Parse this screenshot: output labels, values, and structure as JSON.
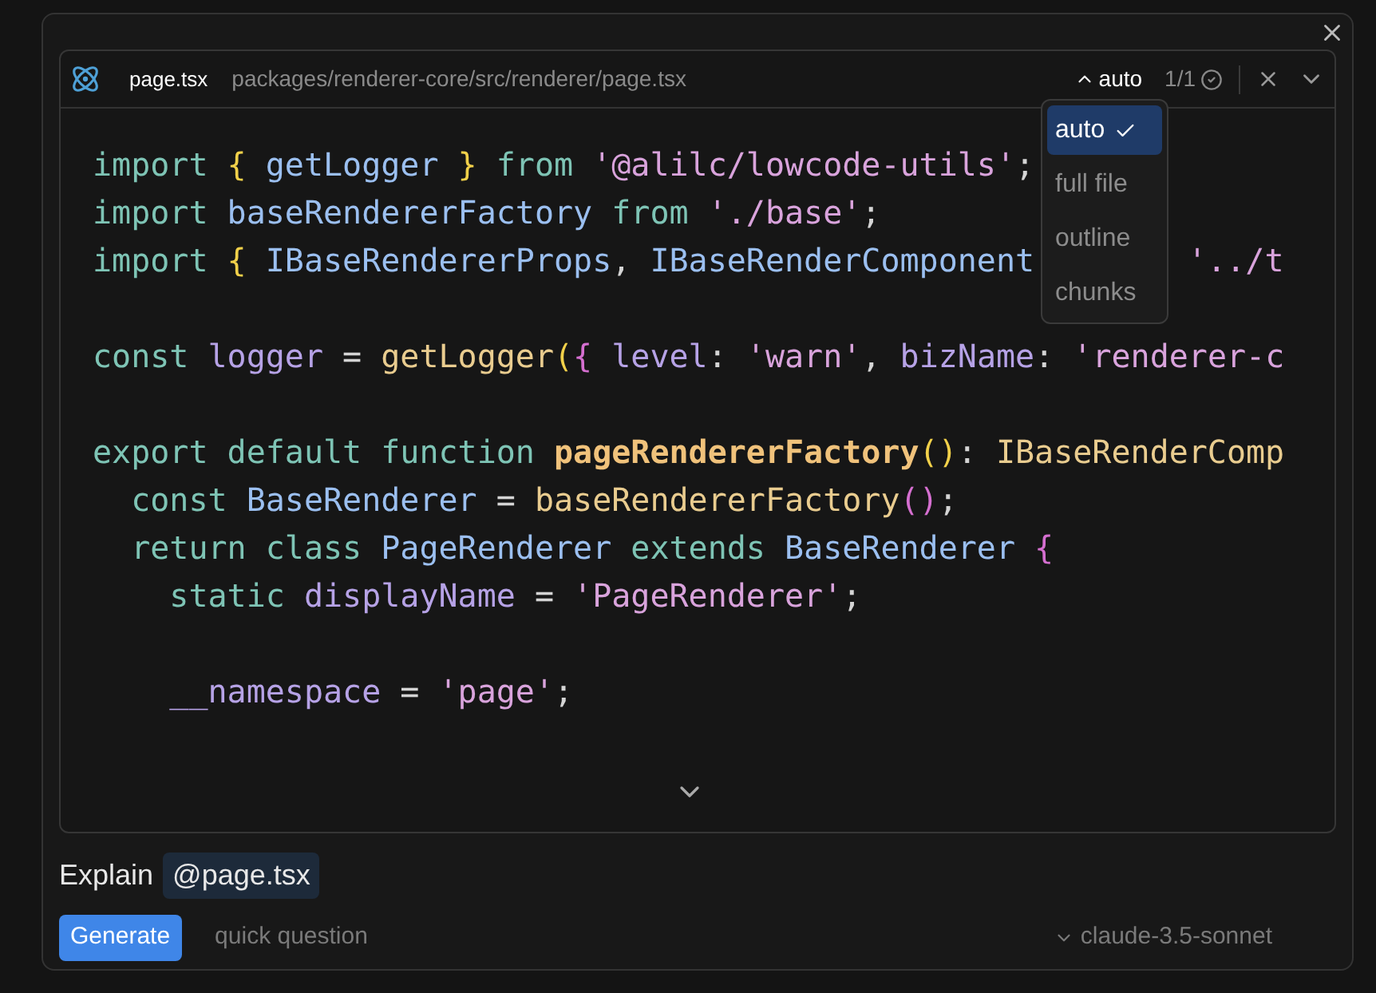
{
  "header": {
    "file_name": "page.tsx",
    "path": "packages/renderer-core/src/renderer/page.tsx",
    "mode": "auto",
    "count": "1/1"
  },
  "mode_menu": [
    {
      "label": "auto",
      "selected": true
    },
    {
      "label": "full file",
      "selected": false
    },
    {
      "label": "outline",
      "selected": false
    },
    {
      "label": "chunks",
      "selected": false
    }
  ],
  "code_lines": [
    {
      "kind": "code",
      "tokens": [
        {
          "kind": "kw",
          "text": "import "
        },
        {
          "kind": "brace",
          "text": "{"
        },
        {
          "kind": "ident",
          "text": " getLogger "
        },
        {
          "kind": "brace",
          "text": "}"
        },
        {
          "kind": "kw",
          "text": " from "
        },
        {
          "kind": "string",
          "text": "'@alilc/lowcode-utils'"
        },
        {
          "kind": "punct",
          "text": ";"
        }
      ]
    },
    {
      "kind": "code",
      "tokens": [
        {
          "kind": "kw",
          "text": "import "
        },
        {
          "kind": "ident",
          "text": "baseRendererFactory"
        },
        {
          "kind": "kw",
          "text": " from "
        },
        {
          "kind": "string",
          "text": "'./base'"
        },
        {
          "kind": "punct",
          "text": ";"
        }
      ]
    },
    {
      "kind": "split",
      "tokens": [
        {
          "kind": "kw",
          "text": "import "
        },
        {
          "kind": "brace",
          "text": "{"
        },
        {
          "kind": "ident",
          "text": " IBaseRendererProps"
        },
        {
          "kind": "punct",
          "text": ", "
        },
        {
          "kind": "ident",
          "text": "IBaseRenderComponent"
        }
      ],
      "tail_tokens": [
        {
          "kind": "string",
          "text": "'../t"
        }
      ]
    },
    {
      "kind": "blank"
    },
    {
      "kind": "code",
      "tokens": [
        {
          "kind": "kw",
          "text": "const "
        },
        {
          "kind": "var",
          "text": "logger"
        },
        {
          "kind": "punct",
          "text": " = "
        },
        {
          "kind": "fn",
          "text": "getLogger"
        },
        {
          "kind": "brace",
          "text": "("
        },
        {
          "kind": "paren",
          "text": "{"
        },
        {
          "kind": "var",
          "text": " level"
        },
        {
          "kind": "punct",
          "text": ": "
        },
        {
          "kind": "string",
          "text": "'warn'"
        },
        {
          "kind": "punct",
          "text": ", "
        },
        {
          "kind": "var",
          "text": "bizName"
        },
        {
          "kind": "punct",
          "text": ": "
        },
        {
          "kind": "string",
          "text": "'renderer-c"
        }
      ]
    },
    {
      "kind": "blank"
    },
    {
      "kind": "code",
      "tokens": [
        {
          "kind": "kw",
          "text": "export default function "
        },
        {
          "kind": "fnbold",
          "text": "pageRendererFactory"
        },
        {
          "kind": "brace",
          "text": "()"
        },
        {
          "kind": "punct",
          "text": ": "
        },
        {
          "kind": "fn",
          "text": "IBaseRenderComp"
        }
      ]
    },
    {
      "kind": "code",
      "tokens": [
        {
          "kind": "kw",
          "text": "  const "
        },
        {
          "kind": "ident",
          "text": "BaseRenderer"
        },
        {
          "kind": "punct",
          "text": " = "
        },
        {
          "kind": "fn",
          "text": "baseRendererFactory"
        },
        {
          "kind": "paren",
          "text": "()"
        },
        {
          "kind": "punct",
          "text": ";"
        }
      ]
    },
    {
      "kind": "code",
      "tokens": [
        {
          "kind": "kw",
          "text": "  return class "
        },
        {
          "kind": "ident",
          "text": "PageRenderer"
        },
        {
          "kind": "kw",
          "text": " extends "
        },
        {
          "kind": "ident",
          "text": "BaseRenderer"
        },
        {
          "kind": "paren",
          "text": " {"
        }
      ]
    },
    {
      "kind": "code",
      "tokens": [
        {
          "kind": "kw",
          "text": "    static "
        },
        {
          "kind": "var",
          "text": "displayName"
        },
        {
          "kind": "punct",
          "text": " = "
        },
        {
          "kind": "string",
          "text": "'PageRenderer'"
        },
        {
          "kind": "punct",
          "text": ";"
        }
      ]
    },
    {
      "kind": "blank"
    },
    {
      "kind": "code",
      "tokens": [
        {
          "kind": "var",
          "text": "    __namespace"
        },
        {
          "kind": "punct",
          "text": " = "
        },
        {
          "kind": "string",
          "text": "'page'"
        },
        {
          "kind": "punct",
          "text": ";"
        }
      ]
    }
  ],
  "prompt": {
    "text": "Explain",
    "mention": "@page.tsx"
  },
  "footer": {
    "generate": "Generate",
    "quick": "quick question",
    "model": "claude-3.5-sonnet"
  }
}
